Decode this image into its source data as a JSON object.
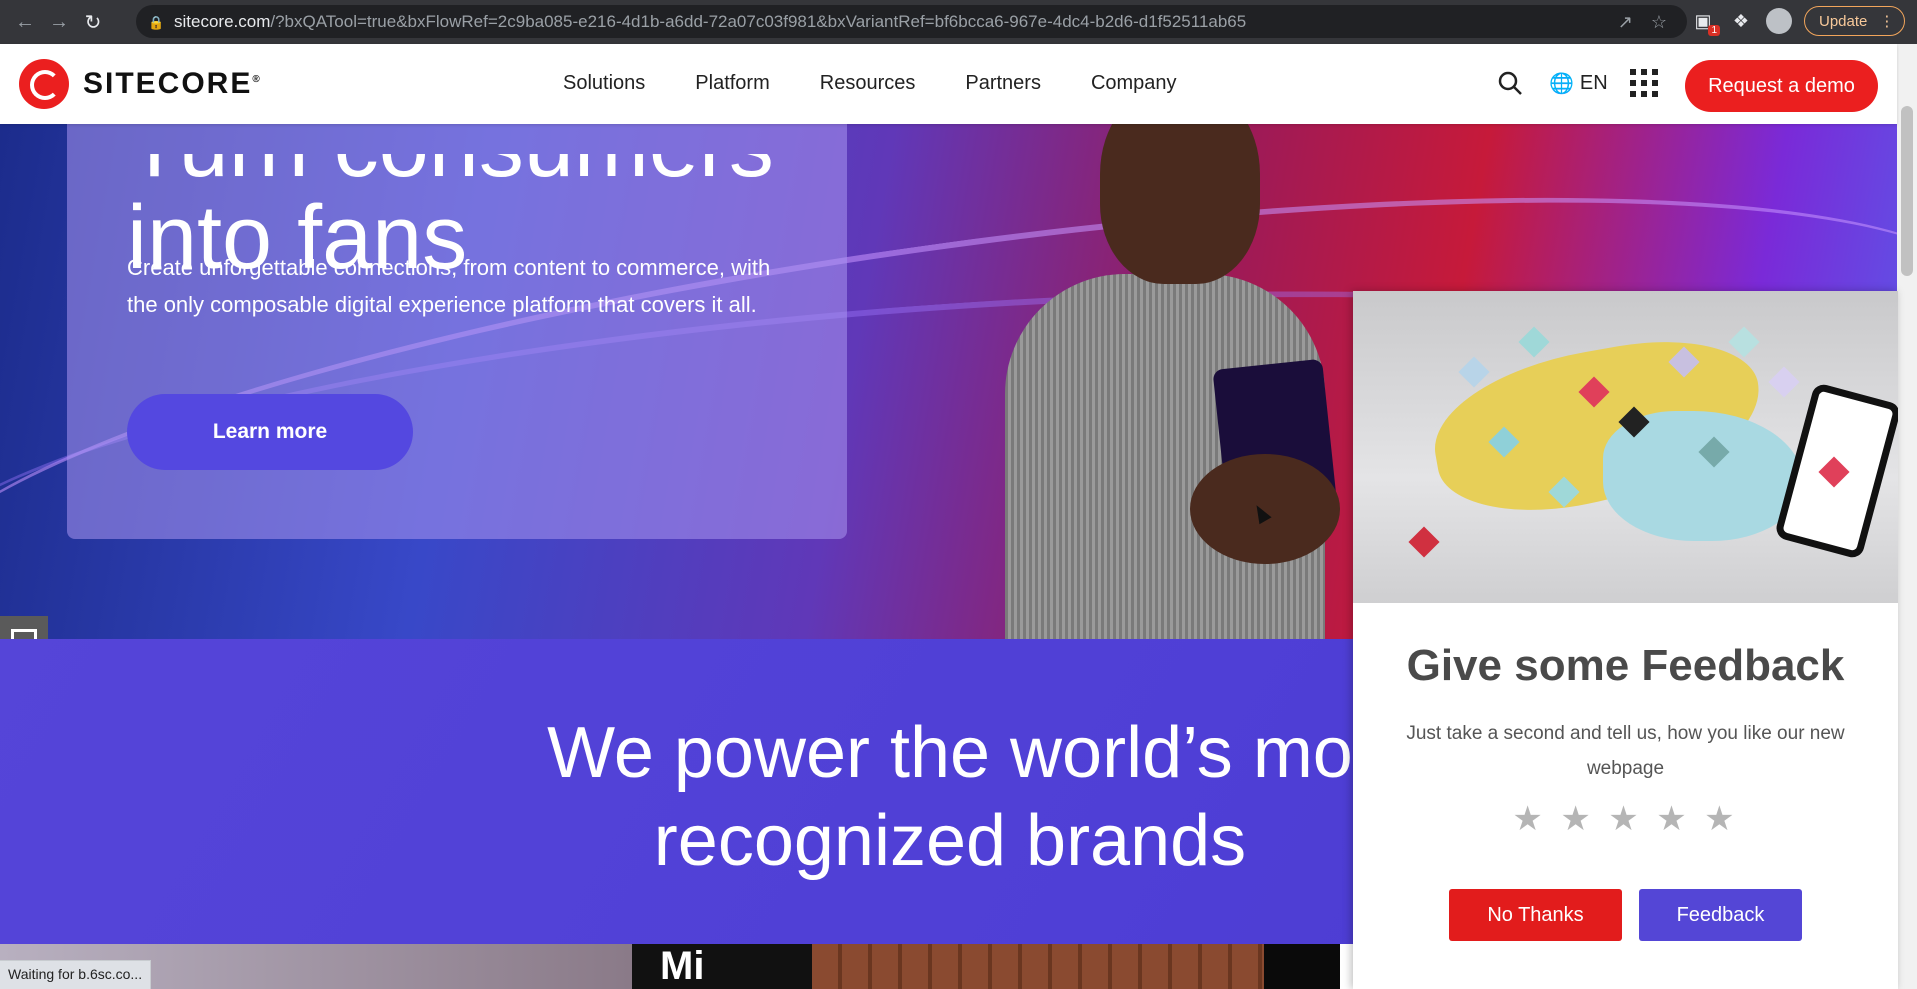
{
  "browser": {
    "url_host": "sitecore.com",
    "url_path": "/?bxQATool=true&bxFlowRef=2c9ba085-e216-4d1b-a6dd-72a07c03f981&bxVariantRef=bf6bcca6-967e-4dc4-b2d6-d1f52511ab65",
    "extension_badge": "1",
    "update_label": "Update",
    "status_text": "Waiting for b.6sc.co..."
  },
  "header": {
    "logo_text": "SITECORE",
    "logo_mark": "®",
    "nav": [
      "Solutions",
      "Platform",
      "Resources",
      "Partners",
      "Company"
    ],
    "language": "EN",
    "demo_label": "Request a demo"
  },
  "hero": {
    "title_line1": "Turn consumers",
    "title_line2": "into fans",
    "description": "Create unforgettable connections, from content to commerce, with the only composable digital experience platform that covers it all.",
    "cta_label": "Learn more"
  },
  "brands": {
    "title_line1": "We power the world’s mo",
    "title_line2": "recognized brands",
    "strip_text": "Mi"
  },
  "feedback": {
    "title": "Give some Feedback",
    "text": "Just take a second and tell us, how you like our new webpage",
    "stars": [
      "★",
      "★",
      "★",
      "★",
      "★"
    ],
    "no_label": "No Thanks",
    "yes_label": "Feedback"
  },
  "colors": {
    "brand_red": "#eb1f1f",
    "brand_purple": "#5446d6"
  }
}
